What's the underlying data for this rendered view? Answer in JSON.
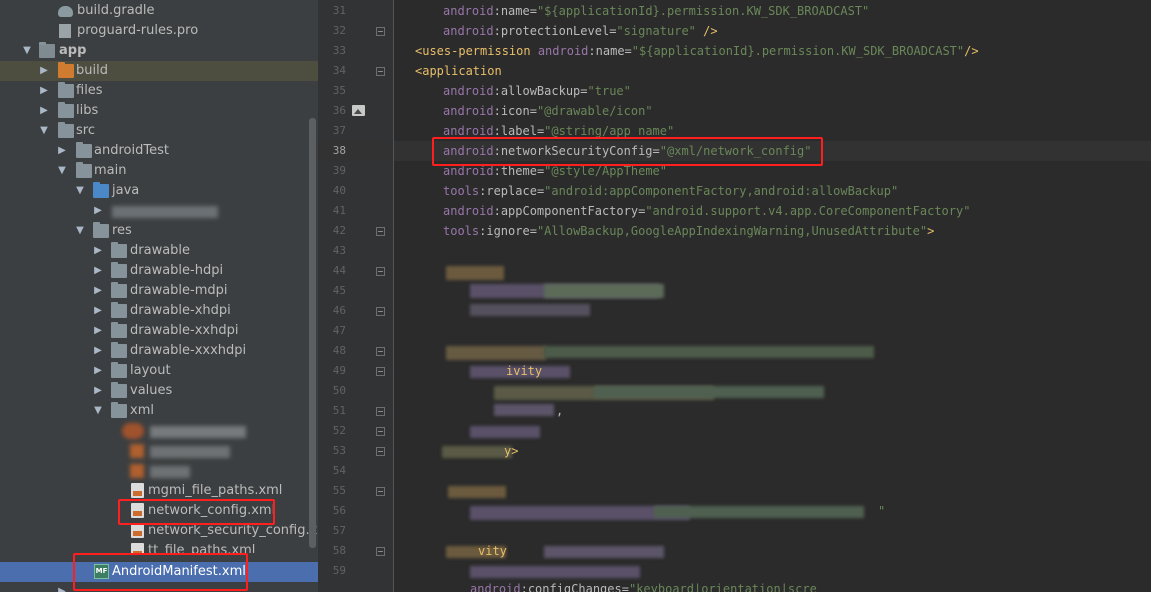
{
  "tree": {
    "rows": [
      {
        "label": "build.gradle",
        "type": "gradle"
      },
      {
        "label": "proguard-rules.pro",
        "type": "pro"
      },
      {
        "label": "app",
        "type": "module"
      },
      {
        "label": "build",
        "type": "folder"
      },
      {
        "label": "files",
        "type": "folder"
      },
      {
        "label": "libs",
        "type": "folder"
      },
      {
        "label": "src",
        "type": "folder"
      },
      {
        "label": "androidTest",
        "type": "folder"
      },
      {
        "label": "main",
        "type": "folder"
      },
      {
        "label": "java",
        "type": "folder"
      },
      {
        "label": "",
        "type": "blurred"
      },
      {
        "label": "res",
        "type": "folder"
      },
      {
        "label": "drawable",
        "type": "folder"
      },
      {
        "label": "drawable-hdpi",
        "type": "folder"
      },
      {
        "label": "drawable-mdpi",
        "type": "folder"
      },
      {
        "label": "drawable-xhdpi",
        "type": "folder"
      },
      {
        "label": "drawable-xxhdpi",
        "type": "folder"
      },
      {
        "label": "drawable-xxxhdpi",
        "type": "folder"
      },
      {
        "label": "layout",
        "type": "folder"
      },
      {
        "label": "values",
        "type": "folder"
      },
      {
        "label": "xml",
        "type": "folder"
      },
      {
        "label": "",
        "type": "blurred"
      },
      {
        "label": "",
        "type": "blurred"
      },
      {
        "label": "mgmi_file_paths.xml",
        "type": "xml"
      },
      {
        "label": "network_config.xml",
        "type": "xml"
      },
      {
        "label": "network_security_config.xml",
        "type": "xml"
      },
      {
        "label": "tt_file_paths.xml",
        "type": "xml"
      },
      {
        "label": "AndroidManifest.xml",
        "type": "manifest"
      }
    ],
    "manifest_badge": "MF"
  },
  "editor": {
    "line_numbers": [
      "31",
      "32",
      "33",
      "34",
      "35",
      "36",
      "37",
      "38",
      "39",
      "40",
      "41",
      "42",
      "43",
      "44",
      "45",
      "46",
      "47",
      "48",
      "49",
      "50",
      "51",
      "52",
      "53",
      "54",
      "55",
      "56",
      "57",
      "58",
      "59"
    ],
    "current_line": "38",
    "code": {
      "l31": [
        "android",
        ":",
        "name",
        "=",
        "\"${applicationId}.permission.KW_SDK_BROADCAST\""
      ],
      "l32": [
        "android",
        ":",
        "protectionLevel",
        "=",
        "\"signature\"",
        "/>"
      ],
      "l33": [
        "<uses-permission ",
        "android",
        ":",
        "name",
        "=",
        "\"${applicationId}.permission.KW_SDK_BROADCAST\"",
        "/>"
      ],
      "l34": [
        "<application"
      ],
      "l35": [
        "android",
        ":",
        "allowBackup",
        "=",
        "\"true\""
      ],
      "l36": [
        "android",
        ":",
        "icon",
        "=",
        "\"@drawable/icon\""
      ],
      "l37": [
        "android",
        ":",
        "label",
        "=",
        "\"@string/app_name\""
      ],
      "l38": [
        "android",
        ":",
        "networkSecurityConfig",
        "=",
        "\"@xml/network_config\""
      ],
      "l39": [
        "android",
        ":",
        "theme",
        "=",
        "\"@style/AppTheme\""
      ],
      "l40": [
        "tools",
        ":",
        "replace",
        "=",
        "\"android:appComponentFactory,android:allowBackup\""
      ],
      "l41": [
        "android",
        ":",
        "appComponentFactory",
        "=",
        "\"android.support.v4.app.CoreComponentFactory\""
      ],
      "l42": [
        "tools",
        ":",
        "ignore",
        "=",
        "\"AllowBackup,GoogleAppIndexingWarning,UnusedAttribute\"",
        ">"
      ],
      "l49": "ivity",
      "l51": ",",
      "l53": "y>",
      "l56": "\"",
      "l57": "vity",
      "l59": [
        "android",
        ":",
        "configChanges",
        "=",
        "\"keyboard|orientation|scre"
      ]
    }
  },
  "colors": {
    "highlight": "#ff1f1f",
    "selection": "#4b6eaf",
    "tag": "#e8bf6a",
    "namespace": "#9876aa",
    "value": "#6a8759"
  }
}
